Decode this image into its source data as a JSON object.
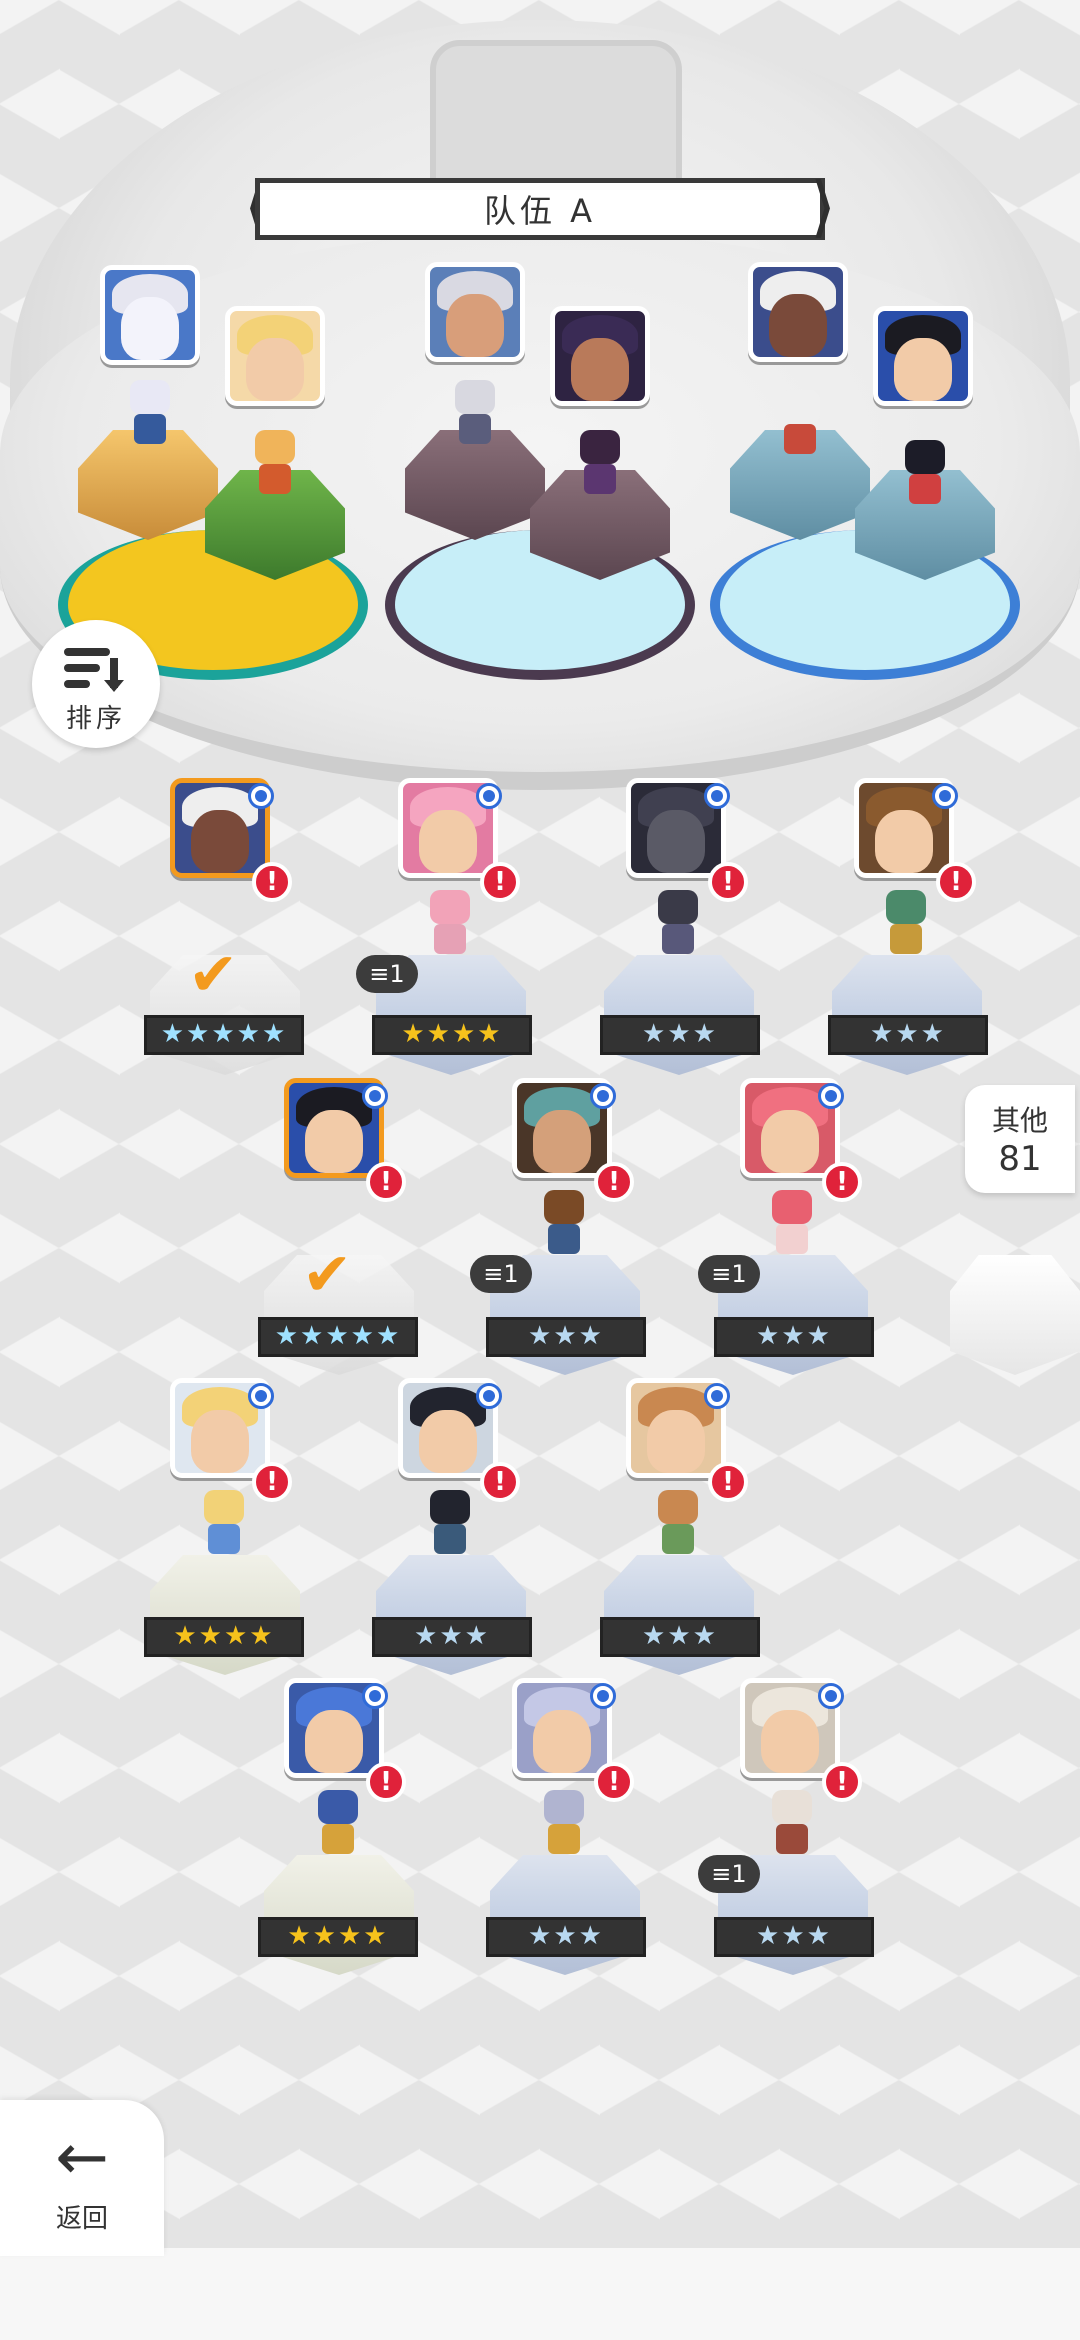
{
  "team": {
    "title": "队伍 A",
    "prev_arrow": "⟨",
    "next_arrow": "⟩"
  },
  "sort_button": {
    "label": "排序"
  },
  "other_button": {
    "label": "其他",
    "count": "81"
  },
  "back_button": {
    "label": "返回"
  },
  "roster": [
    {
      "stars": "★★★★★",
      "copies": ""
    },
    {
      "stars": "★★★★",
      "copies": "1"
    },
    {
      "stars": "★★★",
      "copies": ""
    },
    {
      "stars": "★★★",
      "copies": ""
    },
    {
      "stars": "★★★★★",
      "copies": ""
    },
    {
      "stars": "★★★",
      "copies": "1"
    },
    {
      "stars": "★★★",
      "copies": "1"
    },
    {
      "stars": "★★★★",
      "copies": ""
    },
    {
      "stars": "★★★",
      "copies": ""
    },
    {
      "stars": "★★★",
      "copies": ""
    },
    {
      "stars": "★★★★",
      "copies": ""
    },
    {
      "stars": "★★★",
      "copies": ""
    },
    {
      "stars": "★★★",
      "copies": "1"
    }
  ],
  "alert_glyph": "!",
  "check_glyph": "✔",
  "colors": {
    "slot_gold": "#f3c61f",
    "slot_purple": "#4b3a4f",
    "slot_blue": "#3d7fd6",
    "alert": "#e0223a",
    "selected": "#f39a1e"
  }
}
